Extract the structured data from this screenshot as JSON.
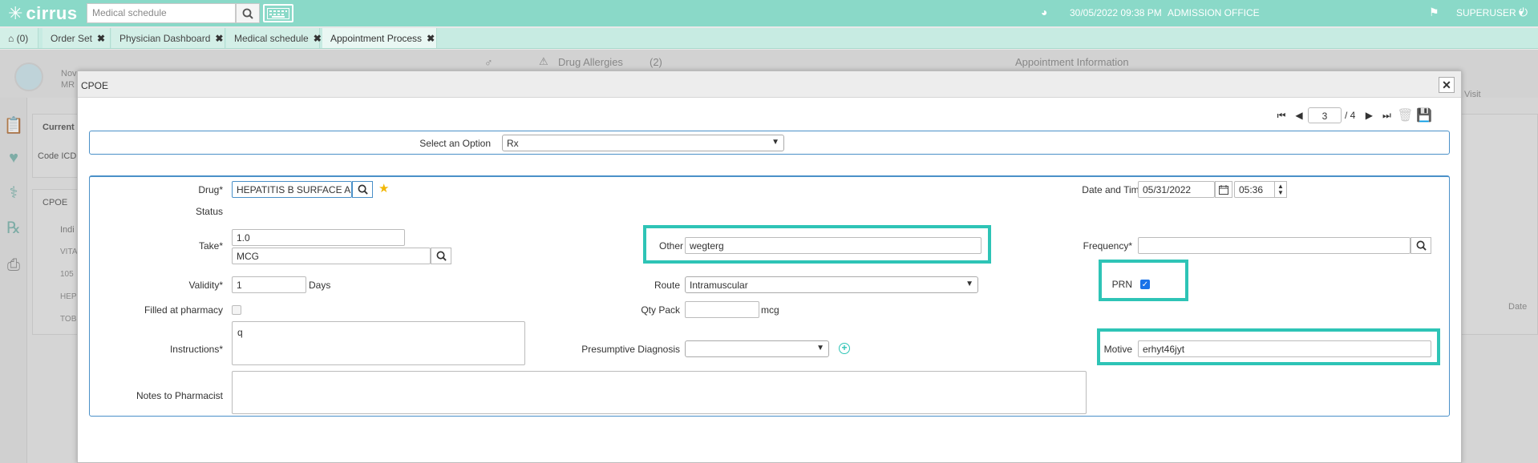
{
  "topbar": {
    "logo_text": "cirrus",
    "search_placeholder": "Medical schedule",
    "datetime": "30/05/2022 09:38 PM",
    "office": "ADMISSION OFFICE",
    "user": "SUPERUSER"
  },
  "tabs": [
    {
      "label": "(0)"
    },
    {
      "label": "Order Set"
    },
    {
      "label": "Physician Dashboard"
    },
    {
      "label": "Medical schedule"
    },
    {
      "label": "Appointment Process"
    }
  ],
  "background": {
    "drug_allergies_label": "Drug Allergies",
    "drug_allergies_count": "(2)",
    "appointment_info": "Appointment Information",
    "patient_name_partial": "Nov",
    "patient_mrn_partial": "MR",
    "visit_partial": "Visit",
    "current_partial": "Current",
    "code_icd_partial": "Code ICD",
    "cpoe_label": "CPOE",
    "indi_partial": "Indi",
    "list_items": [
      "VITA",
      "105",
      "HEP",
      "TOB"
    ],
    "date_col": "Date"
  },
  "modal": {
    "title": "CPOE",
    "pager": {
      "current": "3",
      "total": "/ 4"
    },
    "select_option_label": "Select an Option",
    "select_option_value": "Rx",
    "form": {
      "drug_label": "Drug*",
      "drug_value": "HEPATITIS B SURFACE ANTIGEN",
      "status_label": "Status",
      "take_label": "Take*",
      "take_value": "1.0",
      "take_unit": "MCG",
      "validity_label": "Validity*",
      "validity_value": "1",
      "validity_unit": "Days",
      "filled_label": "Filled at pharmacy",
      "instructions_label": "Instructions*",
      "instructions_value": "q",
      "notes_label": "Notes to Pharmacist",
      "notes_value": "",
      "other_label": "Other",
      "other_value": "wegterg",
      "route_label": "Route",
      "route_value": "Intramuscular",
      "qty_label": "Qty Pack",
      "qty_value": "",
      "qty_unit": "mcg",
      "diagnosis_label": "Presumptive Diagnosis",
      "diagnosis_value": "",
      "datetime_label": "Date and Time*",
      "date_value": "05/31/2022",
      "time_value": "05:36",
      "frequency_label": "Frequency*",
      "frequency_value": "",
      "prn_label": "PRN",
      "prn_checked": true,
      "motive_label": "Motive",
      "motive_value": "erhyt46jyt"
    }
  },
  "colors": {
    "topbar": "#8ad9c8",
    "highlight": "#2ec4b6",
    "border_blue": "#4a90c8"
  }
}
